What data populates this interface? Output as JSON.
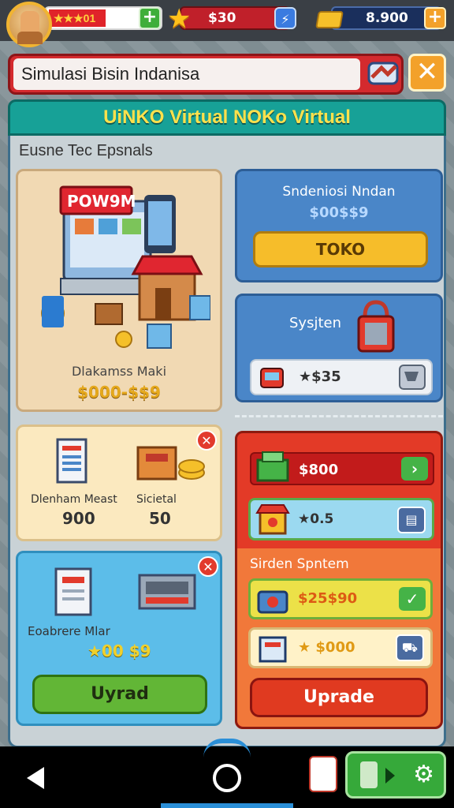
{
  "hud": {
    "player_flag_text": "★★★01",
    "stars_value": "$30",
    "gold_value": "8.900",
    "plus_label": "+",
    "swap_label": "⚡"
  },
  "title_bar": {
    "title": "Simulasi Bisin Indanisa",
    "close_label": "✕"
  },
  "banner": {
    "title": "UiNKO Virtual NOKo Virtual"
  },
  "section_label": "Eusne Tec   Epsnals",
  "shop_card": {
    "label": "Dlakamss Maki",
    "price": "$000-$$9"
  },
  "order_card": {
    "title": "Sndeniosi Nndan",
    "price": "$00$$9",
    "button_label": "TOKO"
  },
  "system_card": {
    "title": "Sysjten",
    "row_value": "★$35"
  },
  "stats_card": {
    "label_1": "Dlenham Meast",
    "label_2": "Sicietal",
    "value_1": "900",
    "value_2": "50",
    "close_label": "✕"
  },
  "upgrade_card": {
    "label": "Eoabrere Mlar",
    "price": "★00 $9",
    "button_label": "Uyrad",
    "close_label": "✕"
  },
  "red_card": {
    "row1_value": "$800",
    "row2_value": "★0.5",
    "section_title": "Sirden Spntem",
    "row3_value": "$25$90",
    "row4_value": "★ $000",
    "button_label": "Uprade"
  },
  "colors": {
    "accent_red": "#d42a2e",
    "accent_teal": "#17a197",
    "accent_gold": "#f6bd2a",
    "accent_green": "#62b636"
  }
}
